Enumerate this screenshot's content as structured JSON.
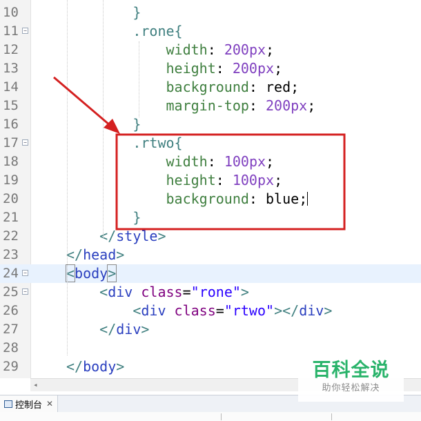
{
  "editor": {
    "lines": [
      {
        "n": "10",
        "fold": false,
        "tokens": [
          {
            "t": "}",
            "c": "tok-brace"
          }
        ],
        "indent": "        "
      },
      {
        "n": "11",
        "fold": true,
        "tokens": [
          {
            "t": ".rone",
            "c": "tok-sel"
          },
          {
            "t": "{",
            "c": "tok-brace"
          }
        ],
        "indent": "        "
      },
      {
        "n": "12",
        "fold": false,
        "tokens": [
          {
            "t": "width",
            "c": "tok-prop"
          },
          {
            "t": ": ",
            "c": "tok-punct"
          },
          {
            "t": "200",
            "c": "tok-num"
          },
          {
            "t": "px",
            "c": "tok-num"
          },
          {
            "t": ";",
            "c": "tok-punct"
          }
        ],
        "indent": "            "
      },
      {
        "n": "13",
        "fold": false,
        "tokens": [
          {
            "t": "height",
            "c": "tok-prop"
          },
          {
            "t": ": ",
            "c": "tok-punct"
          },
          {
            "t": "200",
            "c": "tok-num"
          },
          {
            "t": "px",
            "c": "tok-num"
          },
          {
            "t": ";",
            "c": "tok-punct"
          }
        ],
        "indent": "            "
      },
      {
        "n": "14",
        "fold": false,
        "tokens": [
          {
            "t": "background",
            "c": "tok-prop"
          },
          {
            "t": ": ",
            "c": "tok-punct"
          },
          {
            "t": "red",
            "c": "tok-val"
          },
          {
            "t": ";",
            "c": "tok-punct"
          }
        ],
        "indent": "            "
      },
      {
        "n": "15",
        "fold": false,
        "tokens": [
          {
            "t": "margin-top",
            "c": "tok-prop"
          },
          {
            "t": ": ",
            "c": "tok-punct"
          },
          {
            "t": "200",
            "c": "tok-num"
          },
          {
            "t": "px",
            "c": "tok-num"
          },
          {
            "t": ";",
            "c": "tok-punct"
          }
        ],
        "indent": "            "
      },
      {
        "n": "16",
        "fold": false,
        "tokens": [
          {
            "t": "}",
            "c": "tok-brace"
          }
        ],
        "indent": "        "
      },
      {
        "n": "17",
        "fold": true,
        "tokens": [
          {
            "t": ".rtwo",
            "c": "tok-sel"
          },
          {
            "t": "{",
            "c": "tok-brace"
          }
        ],
        "indent": "        "
      },
      {
        "n": "18",
        "fold": false,
        "tokens": [
          {
            "t": "width",
            "c": "tok-prop"
          },
          {
            "t": ": ",
            "c": "tok-punct"
          },
          {
            "t": "100",
            "c": "tok-num"
          },
          {
            "t": "px",
            "c": "tok-num"
          },
          {
            "t": ";",
            "c": "tok-punct"
          }
        ],
        "indent": "            "
      },
      {
        "n": "19",
        "fold": false,
        "tokens": [
          {
            "t": "height",
            "c": "tok-prop"
          },
          {
            "t": ": ",
            "c": "tok-punct"
          },
          {
            "t": "100",
            "c": "tok-num"
          },
          {
            "t": "px",
            "c": "tok-num"
          },
          {
            "t": ";",
            "c": "tok-punct"
          }
        ],
        "indent": "            "
      },
      {
        "n": "20",
        "fold": false,
        "tokens": [
          {
            "t": "background",
            "c": "tok-prop"
          },
          {
            "t": ": ",
            "c": "tok-punct"
          },
          {
            "t": "blue",
            "c": "tok-val"
          },
          {
            "t": ";",
            "c": "tok-punct"
          },
          {
            "t": "",
            "c": "caret"
          }
        ],
        "indent": "            "
      },
      {
        "n": "21",
        "fold": false,
        "tokens": [
          {
            "t": "}",
            "c": "tok-brace"
          }
        ],
        "indent": "        "
      },
      {
        "n": "22",
        "fold": false,
        "tokens": [
          {
            "t": "</",
            "c": "tok-tagbr"
          },
          {
            "t": "style",
            "c": "tok-tag"
          },
          {
            "t": ">",
            "c": "tok-tagbr"
          }
        ],
        "indent": "    "
      },
      {
        "n": "23",
        "fold": false,
        "tokens": [
          {
            "t": "</",
            "c": "tok-tagbr"
          },
          {
            "t": "head",
            "c": "tok-tag"
          },
          {
            "t": ">",
            "c": "tok-tagbr"
          }
        ],
        "indent": ""
      },
      {
        "n": "24",
        "fold": true,
        "current": true,
        "tokens": [
          {
            "t": "<",
            "c": "tok-tagbr bracket-box"
          },
          {
            "t": "body",
            "c": "tok-tag"
          },
          {
            "t": ">",
            "c": "tok-tagbr bracket-box"
          },
          {
            "t": "",
            "c": "caret"
          }
        ],
        "indent": ""
      },
      {
        "n": "25",
        "fold": true,
        "tokens": [
          {
            "t": "<",
            "c": "tok-tagbr"
          },
          {
            "t": "div",
            "c": "tok-tag"
          },
          {
            "t": " ",
            "c": "tok-punct"
          },
          {
            "t": "class",
            "c": "tok-attr"
          },
          {
            "t": "=",
            "c": "tok-punct"
          },
          {
            "t": "\"rone\"",
            "c": "tok-str"
          },
          {
            "t": ">",
            "c": "tok-tagbr"
          }
        ],
        "indent": "    "
      },
      {
        "n": "26",
        "fold": false,
        "tokens": [
          {
            "t": "<",
            "c": "tok-tagbr"
          },
          {
            "t": "div",
            "c": "tok-tag"
          },
          {
            "t": " ",
            "c": "tok-punct"
          },
          {
            "t": "class",
            "c": "tok-attr"
          },
          {
            "t": "=",
            "c": "tok-punct"
          },
          {
            "t": "\"rtwo\"",
            "c": "tok-str"
          },
          {
            "t": "></",
            "c": "tok-tagbr"
          },
          {
            "t": "div",
            "c": "tok-tag"
          },
          {
            "t": ">",
            "c": "tok-tagbr"
          }
        ],
        "indent": "        "
      },
      {
        "n": "27",
        "fold": false,
        "tokens": [
          {
            "t": "</",
            "c": "tok-tagbr"
          },
          {
            "t": "div",
            "c": "tok-tag"
          },
          {
            "t": ">",
            "c": "tok-tagbr"
          }
        ],
        "indent": "    "
      },
      {
        "n": "28",
        "fold": false,
        "tokens": [],
        "indent": ""
      },
      {
        "n": "29",
        "fold": false,
        "tokens": [
          {
            "t": "</",
            "c": "tok-tagbr"
          },
          {
            "t": "body",
            "c": "tok-tag"
          },
          {
            "t": ">",
            "c": "tok-tagbr"
          }
        ],
        "indent": ""
      }
    ]
  },
  "annotation": {
    "color": "#d42020"
  },
  "scrollbar": {
    "left_arrow": "◂"
  },
  "console": {
    "tab_label": "控制台",
    "close": "✕"
  },
  "watermark": {
    "title": "百科全说",
    "subtitle": "助你轻松解决"
  }
}
